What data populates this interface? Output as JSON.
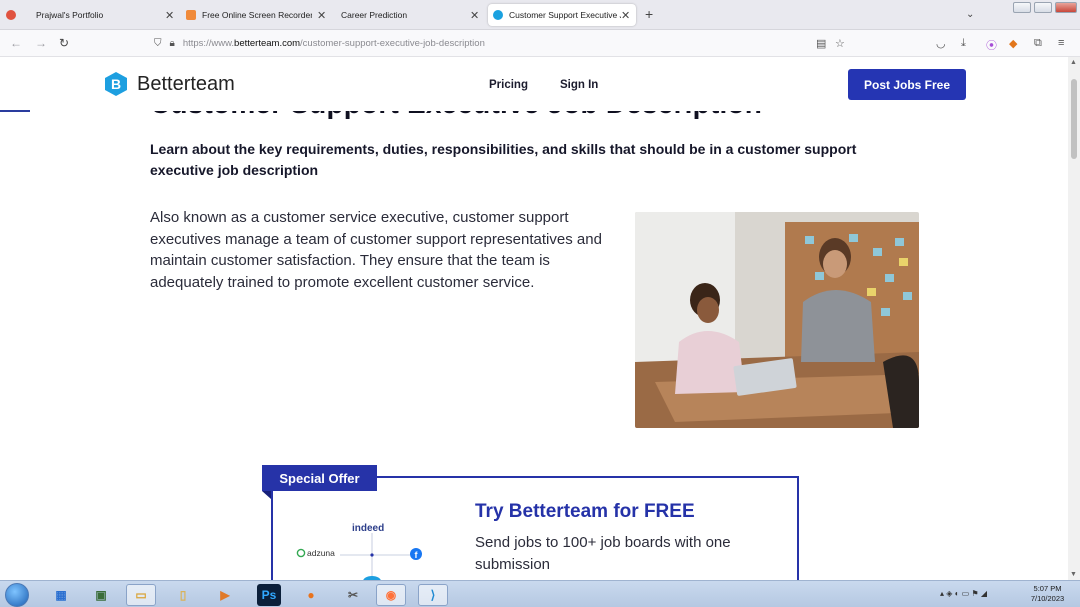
{
  "browser": {
    "tabs": [
      {
        "label": "Prajwal's Portfolio",
        "active": false
      },
      {
        "label": "Free Online Screen Recorder &",
        "active": false
      },
      {
        "label": "Career Prediction",
        "active": false
      },
      {
        "label": "Customer Support Executive Jo",
        "active": true
      }
    ],
    "new_tab_glyph": "+",
    "tab_list_glyph": "⌄",
    "url_prefix": "https://www.",
    "url_host": "betterteam.com",
    "url_path": "/customer-support-executive-job-description"
  },
  "site": {
    "brand": "Betterteam",
    "nav": {
      "pricing": "Pricing",
      "sign_in": "Sign In"
    },
    "cta": "Post Jobs Free",
    "accent_color": "#2535b3"
  },
  "article": {
    "title": "Customer Support Executive Job Description",
    "lead": "Learn about the key requirements, duties, responsibilities, and skills that should be in a customer support executive job description",
    "intro": "Also known as a customer service executive, customer support executives manage a team of customer support representatives and maintain customer satisfaction. They ensure that the team is adequately trained to promote excellent customer service."
  },
  "offer": {
    "badge": "Special Offer",
    "title": "Try Betterteam for FREE",
    "description": "Send jobs to 100+ job boards with one submission",
    "boards": [
      "indeed",
      "adzuna"
    ]
  },
  "taskbar": {
    "time": "5:07 PM",
    "date": "7/10/2023"
  }
}
